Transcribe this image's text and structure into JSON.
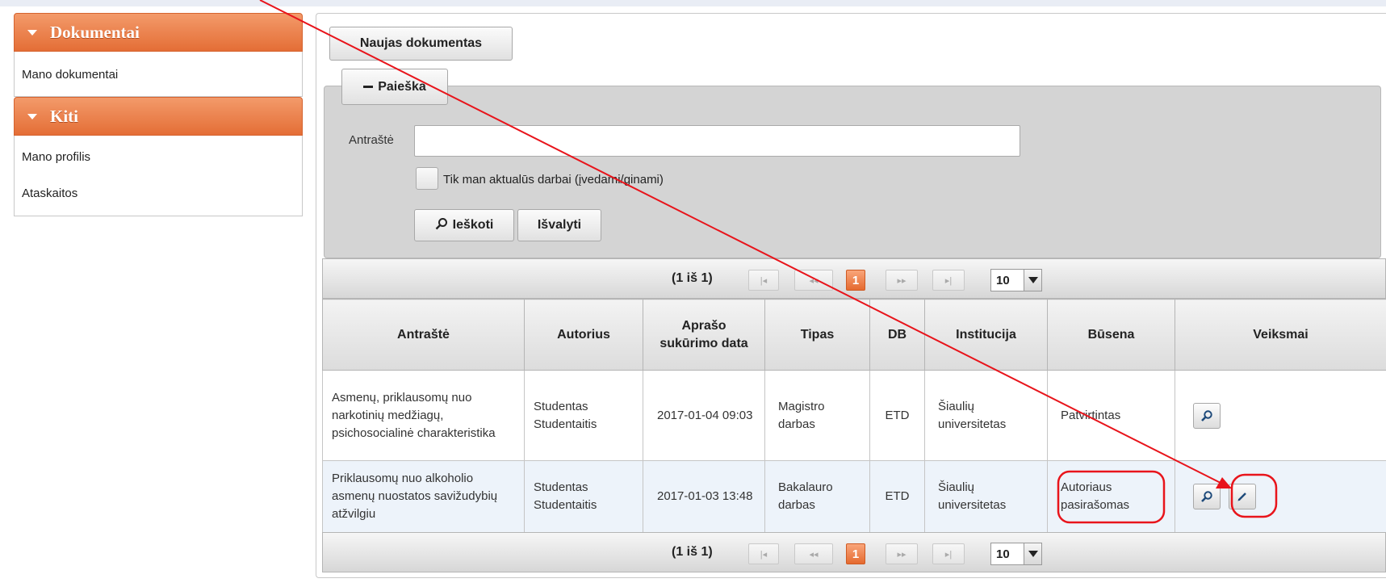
{
  "sidebar": {
    "sections": [
      {
        "title": "Dokumentai",
        "items": [
          "Mano dokumentai"
        ]
      },
      {
        "title": "Kiti",
        "items": [
          "Mano profilis",
          "Ataskaitos"
        ]
      }
    ]
  },
  "toolbar": {
    "new_document_label": "Naujas dokumentas"
  },
  "search": {
    "legend": "Paieška",
    "title_label": "Antraštė",
    "title_value": "",
    "checkbox_label": "Tik man aktualūs darbai (įvedami/ginami)",
    "search_button": "Ieškoti",
    "clear_button": "Išvalyti"
  },
  "pager": {
    "count": "(1 iš 1)",
    "current_page": "1",
    "rows_per_page": "10"
  },
  "table": {
    "columns": [
      "Antraštė",
      "Autorius",
      "Aprašo sukūrimo data",
      "Tipas",
      "DB",
      "Institucija",
      "Būsena",
      "Veiksmai"
    ],
    "rows": [
      {
        "title": "Asmenų, priklausomų nuo narkotinių medžiagų, psichosocialinė charakteristika",
        "author": "Studentas Studentaitis",
        "date": "2017-01-04 09:03",
        "type": "Magistro darbas",
        "db": "ETD",
        "institution": "Šiaulių universitetas",
        "status": "Patvirtintas"
      },
      {
        "title": "Priklausomų nuo alkoholio asmenų nuostatos savižudybių atžvilgiu",
        "author": "Studentas Studentaitis",
        "date": "2017-01-03 13:48",
        "type": "Bakalauro darbas",
        "db": "ETD",
        "institution": "Šiaulių universitetas",
        "status": "Autoriaus pasirašomas"
      }
    ]
  },
  "annotation_color": "#e8141b",
  "accent_color": "#e46e36"
}
